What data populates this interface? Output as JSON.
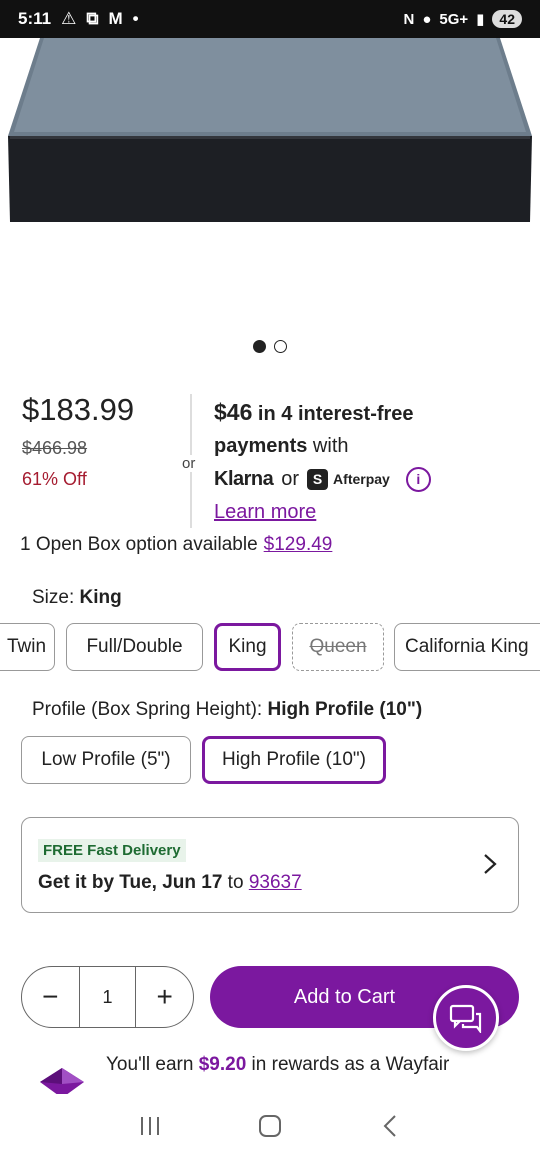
{
  "status_bar": {
    "time": "5:11",
    "network": "5G+",
    "battery": "42"
  },
  "gallery": {
    "dot_count": 2,
    "active_index": 0
  },
  "price": {
    "current": "$183.99",
    "original": "$466.98",
    "discount": "61% Off"
  },
  "financing": {
    "or": "or",
    "amount": "$46",
    "text_1": " in 4 interest-free",
    "text_2_bold": "payments",
    "text_2": " with",
    "klarna": "Klarna",
    "or_2": "or",
    "afterpay_mark": "S",
    "afterpay": "Afterpay",
    "info": "i",
    "learn_more": "Learn more"
  },
  "open_box": {
    "text": "1 Open Box option available",
    "price": "$129.49"
  },
  "size": {
    "label": "Size: ",
    "selected": "King",
    "options": [
      "Twin",
      "Full/Double",
      "King",
      "Queen",
      "California King"
    ]
  },
  "profile": {
    "label": "Profile (Box Spring Height): ",
    "selected": "High Profile (10\")",
    "options": [
      "Low Profile (5\")",
      "High Profile (10\")"
    ]
  },
  "delivery": {
    "badge": "FREE Fast Delivery",
    "get_by": "Get it by Tue, Jun 17",
    "to": " to ",
    "zip": "93637"
  },
  "cart": {
    "quantity": "1",
    "minus": "−",
    "plus": "+",
    "add_label": "Add to Cart"
  },
  "rewards": {
    "prefix": "You'll earn ",
    "amount": "$9.20",
    "suffix": " in rewards as a Wayfair"
  },
  "colors": {
    "accent": "#7b189f",
    "discount": "#a51c30",
    "delivery_green": "#1e6b32"
  }
}
